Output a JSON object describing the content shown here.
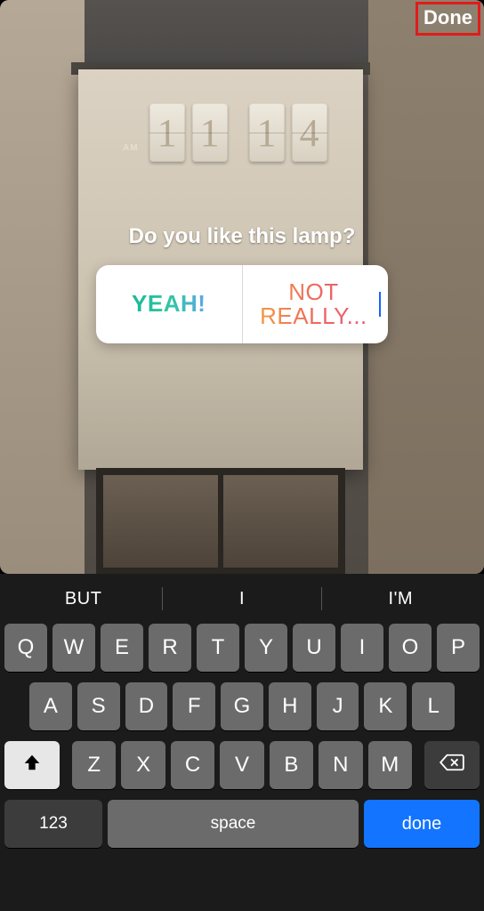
{
  "header": {
    "done_label": "Done"
  },
  "clock": {
    "ampm": "AM",
    "d1": "1",
    "d2": "1",
    "d3": "1",
    "d4": "4"
  },
  "poll": {
    "question": "Do you like this lamp?",
    "option_a": "YEAH!",
    "option_b": "NOT REALLY..."
  },
  "keyboard": {
    "suggestions": [
      "BUT",
      "I",
      "I'M"
    ],
    "row1": [
      "Q",
      "W",
      "E",
      "R",
      "T",
      "Y",
      "U",
      "I",
      "O",
      "P"
    ],
    "row2": [
      "A",
      "S",
      "D",
      "F",
      "G",
      "H",
      "J",
      "K",
      "L"
    ],
    "row3": [
      "Z",
      "X",
      "C",
      "V",
      "B",
      "N",
      "M"
    ],
    "num_switch": "123",
    "space": "space",
    "done": "done"
  }
}
